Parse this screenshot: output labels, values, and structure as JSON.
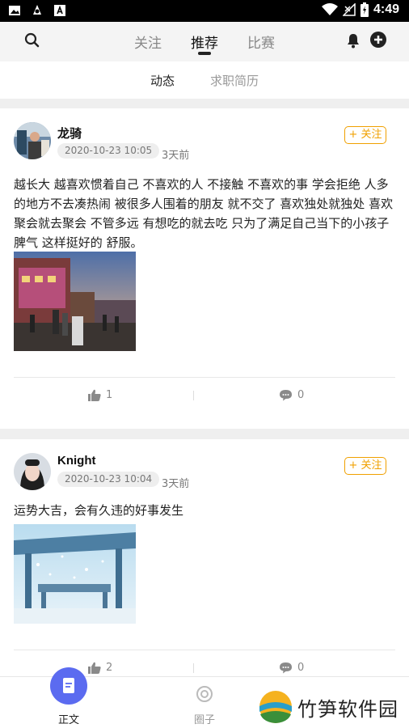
{
  "status_bar": {
    "time": "4:49"
  },
  "top_nav": {
    "tabs": [
      {
        "label": "关注"
      },
      {
        "label": "推荐"
      },
      {
        "label": "比赛"
      }
    ]
  },
  "sub_tabs": [
    {
      "label": "动态"
    },
    {
      "label": "求职简历"
    }
  ],
  "posts": [
    {
      "author": "龙骑",
      "timestamp": "2020-10-23 10:05",
      "ago": "3天前",
      "follow_label": "+ 关注",
      "text": "越长大 越喜欢惯着自己 不喜欢的人 不接触 不喜欢的事 学会拒绝 人多的地方不去凑热闹 被很多人围着的朋友 就不交了 喜欢独处就独处 喜欢聚会就去聚会 不管多远 有想吃的就去吃 只为了满足自己当下的小孩子脾气 这样挺好的 舒服。",
      "likes": "1",
      "comments": "0"
    },
    {
      "author": "Knight",
      "timestamp": "2020-10-23 10:04",
      "ago": "3天前",
      "follow_label": "+ 关注",
      "text": "运势大吉，会有久违的好事发生",
      "likes": "2",
      "comments": "0"
    }
  ],
  "bottom_nav": {
    "items": [
      {
        "label": "正文"
      },
      {
        "label": "圈子"
      }
    ]
  },
  "watermark": {
    "text": "竹笋软件园"
  },
  "colors": {
    "accent": "#f0a000",
    "doc_button": "#5b6bf0"
  }
}
